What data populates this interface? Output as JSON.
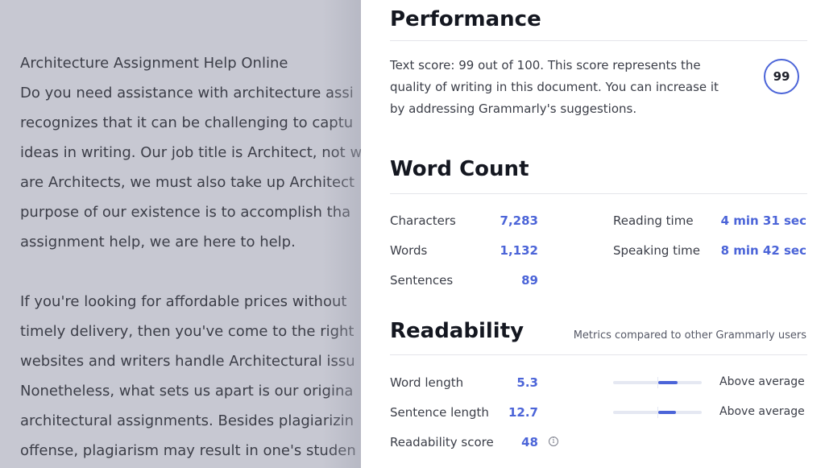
{
  "document": {
    "lines": [
      "Architecture Assignment Help Online",
      "Do you need assistance with architecture assi",
      "recognizes that it can be challenging to captu",
      "ideas in writing. Our job title is Architect, not w",
      "are Architects, we must also take up Architect",
      "purpose of our existence is to accomplish tha",
      "assignment help, we are here to help.",
      "",
      "If you're looking for affordable prices without",
      "timely delivery, then you've come to the right",
      "websites and writers handle Architectural issu",
      "Nonetheless, what sets us apart is our origina",
      "architectural assignments. Besides plagiarizin",
      "offense, plagiarism may result in one's studen"
    ]
  },
  "performance": {
    "title": "Performance",
    "text": "Text score: 99 out of 100. This score represents the quality of writing in this document. You can increase it by addressing Grammarly's suggestions.",
    "score": "99"
  },
  "word_count": {
    "title": "Word Count",
    "characters_label": "Characters",
    "characters_value": "7,283",
    "words_label": "Words",
    "words_value": "1,132",
    "sentences_label": "Sentences",
    "sentences_value": "89",
    "reading_label": "Reading time",
    "reading_value": "4 min 31 sec",
    "speaking_label": "Speaking time",
    "speaking_value": "8 min 42 sec"
  },
  "readability": {
    "title": "Readability",
    "note": "Metrics compared to other Grammarly users",
    "word_length_label": "Word length",
    "word_length_value": "5.3",
    "word_length_rating": "Above average",
    "sentence_length_label": "Sentence length",
    "sentence_length_value": "12.7",
    "sentence_length_rating": "Above average",
    "score_label": "Readability score",
    "score_value": "48",
    "info_glyph": "i"
  },
  "colors": {
    "accent": "#4b64d8",
    "doc_overlay": "#c7c8d2"
  },
  "icons": {
    "info": "info-icon"
  }
}
